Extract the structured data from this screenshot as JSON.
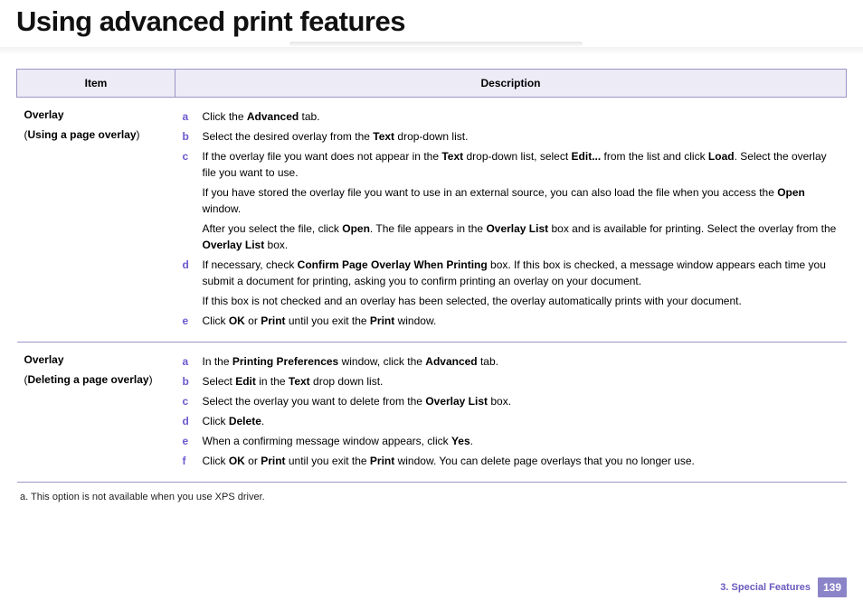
{
  "page_title": "Using advanced print features",
  "table": {
    "headers": {
      "item": "Item",
      "description": "Description"
    },
    "rows": [
      {
        "item_title": "Overlay",
        "item_sub_bold": "Using a page overlay",
        "steps": [
          {
            "m": "a",
            "html": "Click the <b>Advanced</b> tab."
          },
          {
            "m": "b",
            "html": "Select the desired overlay from the <b>Text</b> drop-down list."
          },
          {
            "m": "c",
            "html": "If the overlay file you want does not appear in the <b>Text</b> drop-down list, select <b>Edit...</b> from the list and click <b>Load</b>. Select the overlay file you want to use.",
            "extras": [
              "If you have stored the overlay file you want to use in an external source, you can also load the file when you access the <b>Open</b> window.",
              "After you select the file, click <b>Open</b>. The file appears in the <b>Overlay List</b> box and is available for printing. Select the overlay from the <b>Overlay List</b> box."
            ]
          },
          {
            "m": "d",
            "html": "If necessary, check <b>Confirm Page Overlay When Printing</b> box. If this box is checked, a message window appears each time you submit a document for printing, asking you to confirm printing an overlay on your document.",
            "extras": [
              "If this box is not checked and an overlay has been selected, the overlay automatically prints with your document."
            ]
          },
          {
            "m": "e",
            "html": "Click <b>OK</b> or <b>Print</b> until you exit the <b>Print</b> window."
          }
        ]
      },
      {
        "item_title": "Overlay",
        "item_sub_bold": "Deleting a page overlay",
        "steps": [
          {
            "m": "a",
            "html": "In the <b>Printing Preferences</b> window, click the <b>Advanced</b> tab."
          },
          {
            "m": "b",
            "html": "Select <b>Edit</b> in the <b>Text</b> drop down list."
          },
          {
            "m": "c",
            "html": "Select the overlay you want to delete from the <b>Overlay List</b> box."
          },
          {
            "m": "d",
            "html": "Click <b>Delete</b>."
          },
          {
            "m": "e",
            "html": "When a confirming message window appears, click <b>Yes</b>."
          },
          {
            "m": "f",
            "html": "Click <b>OK</b> or <b>Print</b> until you exit the <b>Print</b> window. You can delete page overlays that you no longer use."
          }
        ]
      }
    ]
  },
  "footnote": "a.  This option is not available when you use XPS driver.",
  "footer": {
    "chapter": "3.  Special Features",
    "page": "139"
  }
}
